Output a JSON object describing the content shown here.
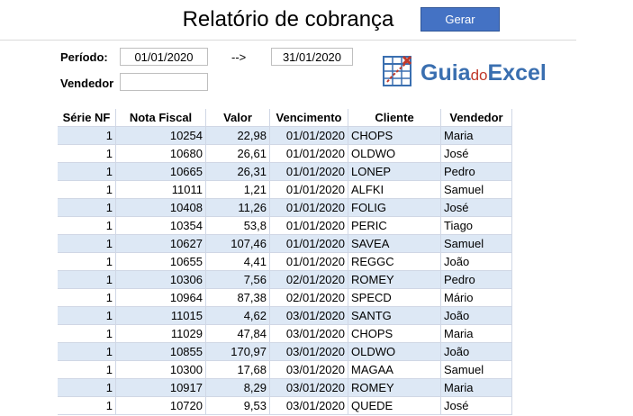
{
  "header": {
    "title": "Relatório de cobrança",
    "gerar_label": "Gerar"
  },
  "filters": {
    "periodo_label": "Período:",
    "data_inicio": "01/01/2020",
    "arrow": "-->",
    "data_fim": "31/01/2020",
    "vendedor_label": "Vendedor",
    "vendedor_value": ""
  },
  "logo": {
    "part1": "Guia",
    "part2": "do",
    "part3": "Excel"
  },
  "colors": {
    "button": "#4472c4",
    "stripe": "#dde8f5",
    "logo_blue": "#3a6fb0",
    "logo_red": "#c0392b"
  },
  "table": {
    "headers": [
      "Série NF",
      "Nota Fiscal",
      "Valor",
      "Vencimento",
      "Cliente",
      "Vendedor"
    ],
    "rows": [
      [
        "1",
        "10254",
        "22,98",
        "01/01/2020",
        "CHOPS",
        "Maria"
      ],
      [
        "1",
        "10680",
        "26,61",
        "01/01/2020",
        "OLDWO",
        "José"
      ],
      [
        "1",
        "10665",
        "26,31",
        "01/01/2020",
        "LONEP",
        "Pedro"
      ],
      [
        "1",
        "11011",
        "1,21",
        "01/01/2020",
        "ALFKI",
        "Samuel"
      ],
      [
        "1",
        "10408",
        "11,26",
        "01/01/2020",
        "FOLIG",
        "José"
      ],
      [
        "1",
        "10354",
        "53,8",
        "01/01/2020",
        "PERIC",
        "Tiago"
      ],
      [
        "1",
        "10627",
        "107,46",
        "01/01/2020",
        "SAVEA",
        "Samuel"
      ],
      [
        "1",
        "10655",
        "4,41",
        "01/01/2020",
        "REGGC",
        "João"
      ],
      [
        "1",
        "10306",
        "7,56",
        "02/01/2020",
        "ROMEY",
        "Pedro"
      ],
      [
        "1",
        "10964",
        "87,38",
        "02/01/2020",
        "SPECD",
        "Mário"
      ],
      [
        "1",
        "11015",
        "4,62",
        "03/01/2020",
        "SANTG",
        "João"
      ],
      [
        "1",
        "11029",
        "47,84",
        "03/01/2020",
        "CHOPS",
        "Maria"
      ],
      [
        "1",
        "10855",
        "170,97",
        "03/01/2020",
        "OLDWO",
        "João"
      ],
      [
        "1",
        "10300",
        "17,68",
        "03/01/2020",
        "MAGAA",
        "Samuel"
      ],
      [
        "1",
        "10917",
        "8,29",
        "03/01/2020",
        "ROMEY",
        "Maria"
      ],
      [
        "1",
        "10720",
        "9,53",
        "03/01/2020",
        "QUEDE",
        "José"
      ]
    ]
  }
}
